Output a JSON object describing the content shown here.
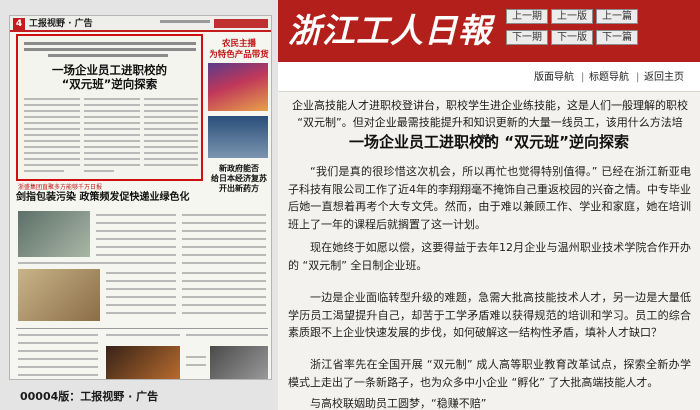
{
  "thumbnail": {
    "page_number": "4",
    "section_label": "工报视野 · 广告",
    "article_title_line1": "一场企业员工进职校的",
    "article_title_line2": "“双元班”逆向探索",
    "side_headline_1": [
      "农民主播",
      "为特色产品带货"
    ],
    "side_headline_2": [
      "新政府能否",
      "给日本经济复苏",
      "开出新药方"
    ],
    "red_kicker": "浙盛集团直聚多方能够千万日报",
    "headline_2": "剑指包装污染 政策频发促快递业绿色化"
  },
  "page_caption": "00004版：工报视野 · 广告",
  "header": {
    "masthead": "浙江工人日報",
    "nav": {
      "prev_issue": "上一期",
      "prev_page": "上一版",
      "prev_article": "上一篇",
      "next_issue": "下一期",
      "next_page": "下一版",
      "next_article": "下一篇"
    }
  },
  "sub_nav": {
    "section_nav": "版面导航",
    "title_nav": "标题导航",
    "home": "返回主页",
    "separator": "|"
  },
  "article": {
    "deck": "企业高技能人才进职校登讲台，职校学生进企业练技能，这是人们一般理解的职校 “双元制”。但对企业最需技能提升和知识更新的大量一线员工，该用什么方法培养？",
    "headline": "一场企业员工进职校的 “双元班”逆向探索",
    "paragraphs": [
      "“我们是真的很珍惜这次机会，所以再忙也觉得特别值得。” 已经在浙江新亚电子科技有限公司工作了近4年的李翔翔毫不掩饰自己重返校园的兴奋之情。中专毕业后她一直想着再考个大专文凭。然而，由于难以兼顾工作、学业和家庭，她在培训班上了一年的课程后就搁置了这一计划。",
      "现在她终于如愿以偿，这要得益于去年12月企业与温州职业技术学院合作开办的 “双元制” 全日制企业班。",
      "一边是企业面临转型升级的难题，急需大批高技能技术人才，另一边是大量低学历员工渴望提升自己，却苦于工学矛盾难以获得规范的培训和学习。员工的综合素质跟不上企业快速发展的步伐，如何破解这一结构性矛盾，填补人才缺口？",
      "浙江省率先在全国开展 “双元制” 成人高等职业教育改革试点，探索全新办学模式上走出了一条新路子，也为众多中小企业 “孵化” 了大批高端技能人才。",
      "与高校联姻助员工圆梦，“稳赚不赔”"
    ]
  },
  "colors": {
    "brand_red": "#b3201c",
    "highlight_red": "#d01010",
    "content_bg": "#f3f2ee"
  }
}
